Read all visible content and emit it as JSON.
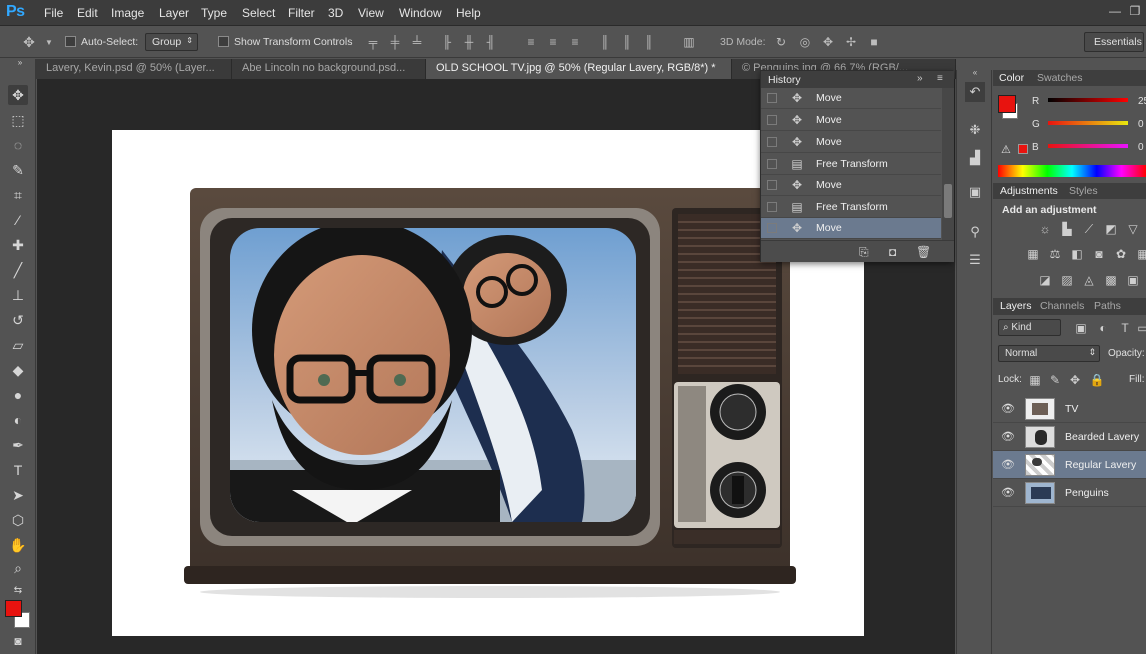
{
  "menubar": {
    "logo": "Ps",
    "items": [
      "File",
      "Edit",
      "Image",
      "Layer",
      "Type",
      "Select",
      "Filter",
      "3D",
      "View",
      "Window",
      "Help"
    ],
    "window_controls": [
      "—",
      "❐",
      "✕"
    ]
  },
  "options": {
    "auto_select_label": "Auto-Select:",
    "auto_select_value": "Group",
    "show_transform_label": "Show Transform Controls",
    "mode_3d_label": "3D Mode:",
    "workspace": "Essentials"
  },
  "tabs": [
    {
      "label": "Lavery, Kevin.psd @ 50% (Layer...",
      "active": false
    },
    {
      "label": "Abe Lincoln no background.psd...",
      "active": false
    },
    {
      "label": "OLD SCHOOL TV.jpg @ 50% (Regular Lavery, RGB/8*) *",
      "active": true
    },
    {
      "label": "© Penguins.jpg @ 66.7% (RGB/...",
      "active": false
    }
  ],
  "history": {
    "title": "History",
    "items": [
      {
        "label": "Move",
        "icon": "move-icon",
        "selected": false
      },
      {
        "label": "Move",
        "icon": "move-icon",
        "selected": false
      },
      {
        "label": "Move",
        "icon": "move-icon",
        "selected": false
      },
      {
        "label": "Free Transform",
        "icon": "document-icon",
        "selected": false
      },
      {
        "label": "Move",
        "icon": "move-icon",
        "selected": false
      },
      {
        "label": "Free Transform",
        "icon": "document-icon",
        "selected": false
      },
      {
        "label": "Move",
        "icon": "move-icon",
        "selected": true
      }
    ]
  },
  "color_panel": {
    "tabs": [
      "Color",
      "Swatches"
    ],
    "foreground": "#e8130f",
    "background": "#ffffff",
    "channels": [
      {
        "label": "R",
        "value": "25"
      },
      {
        "label": "G",
        "value": "0"
      },
      {
        "label": "B",
        "value": "0"
      }
    ]
  },
  "adjustments": {
    "tabs": [
      "Adjustments",
      "Styles"
    ],
    "heading": "Add an adjustment"
  },
  "layers_panel": {
    "tabs": [
      "Layers",
      "Channels",
      "Paths"
    ],
    "filter_label": "Kind",
    "blend_mode": "Normal",
    "opacity_label": "Opacity:",
    "lock_label": "Lock:",
    "fill_label": "Fill:",
    "layers": [
      {
        "name": "TV",
        "selected": false
      },
      {
        "name": "Bearded Lavery",
        "selected": false
      },
      {
        "name": "Regular Lavery",
        "selected": true
      },
      {
        "name": "Penguins",
        "selected": false
      }
    ]
  },
  "colors": {
    "foreground": "#e8130f",
    "panel_bg": "#535353",
    "selection": "#6b7a8f"
  }
}
